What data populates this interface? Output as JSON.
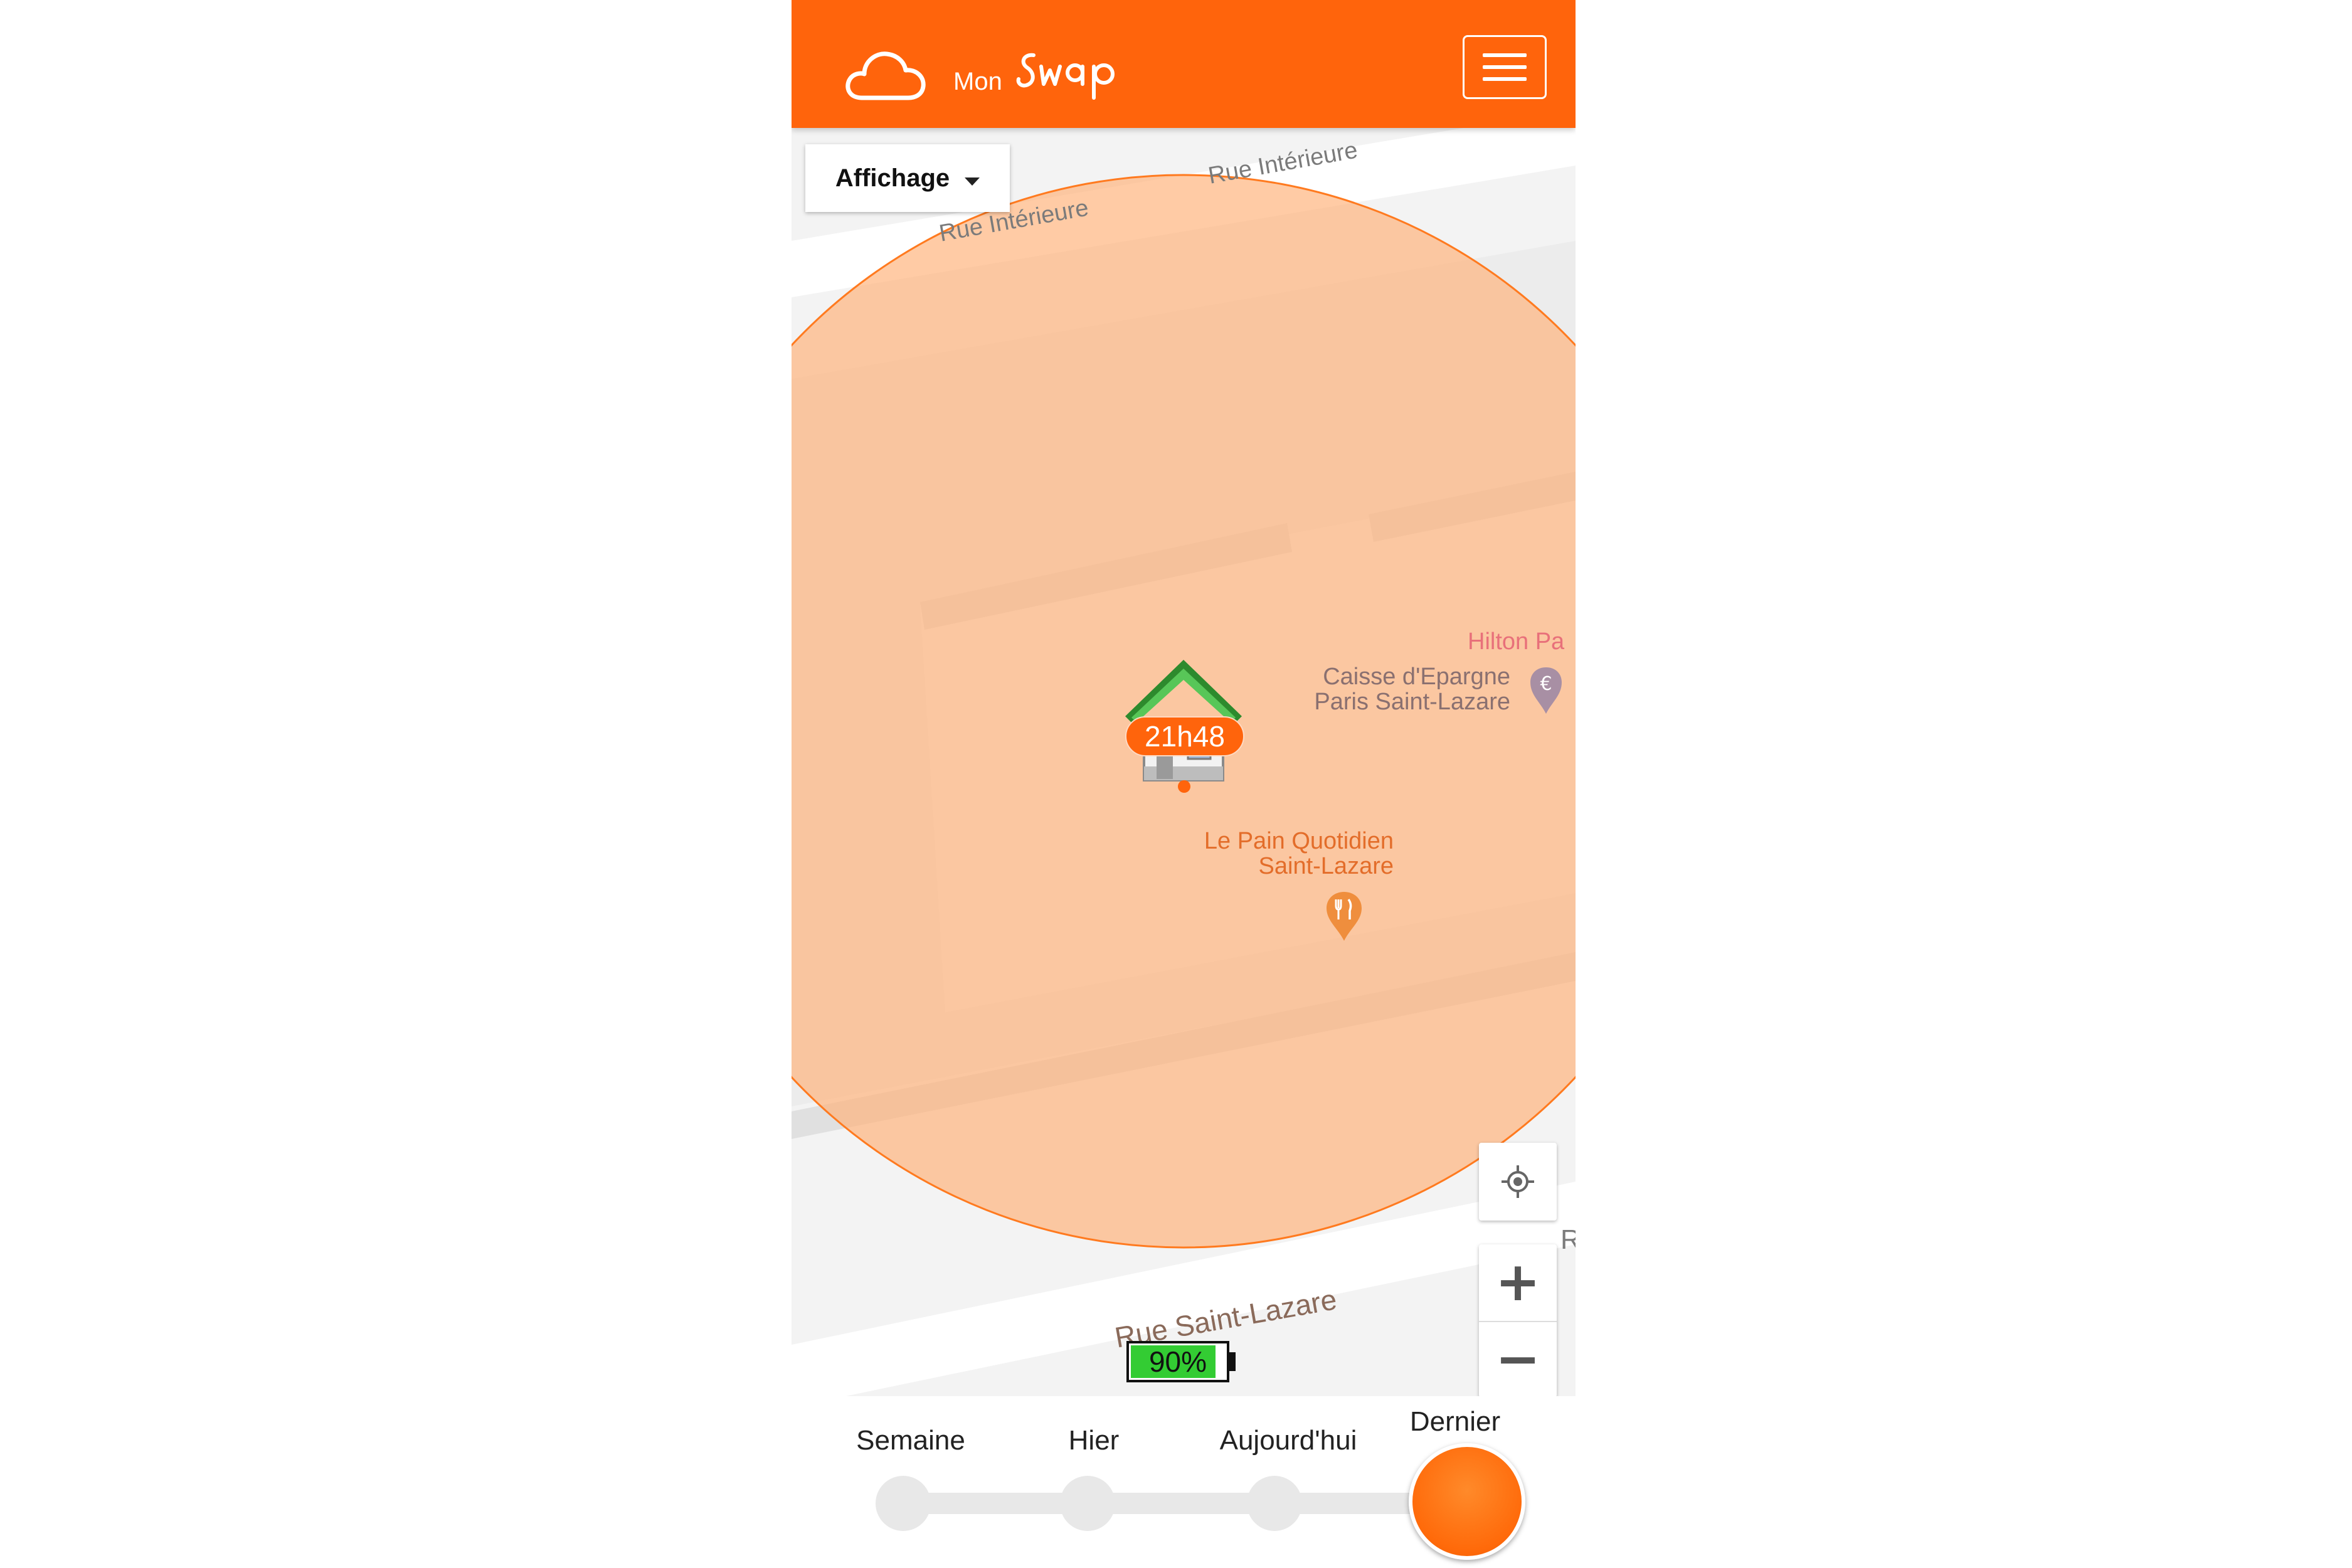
{
  "header": {
    "logo_icon": "cloud-icon",
    "logo_prefix": "Mon",
    "logo_name": "swap",
    "menu_icon": "hamburger-icon",
    "background_color": "#ff640c"
  },
  "map": {
    "display_button_label": "Affichage",
    "streets": [
      "Rue Intérieure",
      "Rue Intérieure",
      "Rue Saint-Lazare",
      "R"
    ],
    "pois": {
      "hilton": "Hilton Pa",
      "bank_line1": "Caisse d'Epargne",
      "bank_line2": "Paris Saint-Lazare",
      "bakery_line1": "Le Pain Quotidien",
      "bakery_line2": "Saint-Lazare"
    },
    "marker": {
      "icon": "house-icon",
      "time": "21h48"
    },
    "accuracy_circle_color": "#ffb27a",
    "controls": {
      "locate_icon": "crosshair-icon",
      "zoom_in": "+",
      "zoom_out": "−"
    },
    "battery": {
      "label": "90%",
      "level": 0.9,
      "color": "#33cc33"
    }
  },
  "timeline": {
    "stops": [
      "Semaine",
      "Hier",
      "Aujourd'hui",
      "Dernier"
    ],
    "selected": "Dernier",
    "handle_color": "#ff6a0a"
  }
}
